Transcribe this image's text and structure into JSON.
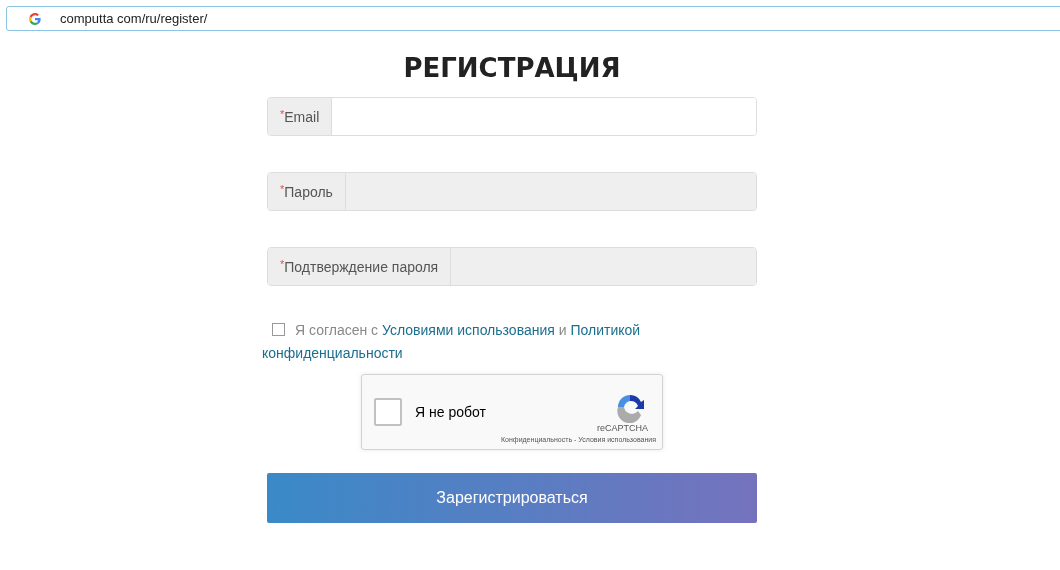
{
  "address_bar": {
    "url": "computta com/ru/register/"
  },
  "title": "РЕГИСТРАЦИЯ",
  "fields": [
    {
      "required_mark": "*",
      "label": "Email",
      "shaded": false
    },
    {
      "required_mark": "*",
      "label": "Пароль",
      "shaded": true
    },
    {
      "required_mark": "*",
      "label": "Подтверждение пароля",
      "shaded": true
    }
  ],
  "agreement": {
    "checked": false,
    "parts": [
      {
        "kind": "text",
        "text": "Я согласен с "
      },
      {
        "kind": "link",
        "text": "Условиями использования"
      },
      {
        "kind": "text",
        "text": " и "
      },
      {
        "kind": "link",
        "text": "Политикой"
      },
      {
        "kind": "link",
        "text": "конфиденциальности"
      }
    ]
  },
  "captcha": {
    "label": "Я не робот",
    "checked": false,
    "brand": "reCAPTCHA",
    "privacy": "Конфиденциальность",
    "separator": "-",
    "terms": "Условия использования"
  },
  "submit": "Зарегистрироваться"
}
